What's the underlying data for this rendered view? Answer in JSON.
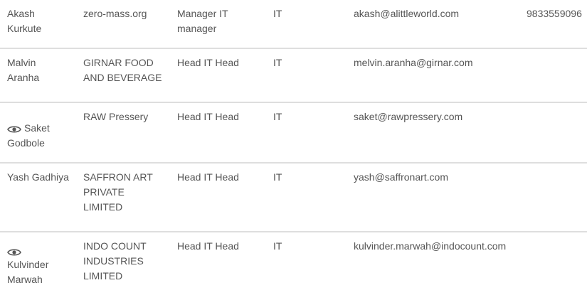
{
  "rows": [
    {
      "name": "Akash Kurkute",
      "viewed": false,
      "company": "zero-mass.org",
      "title": "Manager IT manager",
      "department": "IT",
      "email": "akash@alittleworld.com",
      "phone": "9833559096"
    },
    {
      "name": "Malvin Aranha",
      "viewed": false,
      "company": "GIRNAR FOOD AND BEVERAGE",
      "title": "Head IT Head",
      "department": "IT",
      "email": "melvin.aranha@girnar.com",
      "phone": ""
    },
    {
      "name": "Saket Godbole",
      "viewed": true,
      "company": "RAW Pressery",
      "title": "Head IT Head",
      "department": "IT",
      "email": "saket@rawpressery.com",
      "phone": ""
    },
    {
      "name": "Yash Gadhiya",
      "viewed": false,
      "company": "SAFFRON ART PRIVATE LIMITED",
      "title": "Head IT Head",
      "department": "IT",
      "email": "yash@saffronart.com",
      "phone": ""
    },
    {
      "name": "Kulvinder Marwah",
      "viewed": true,
      "company": "INDO COUNT INDUSTRIES LIMITED",
      "title": "Head IT Head",
      "department": "IT",
      "email": "kulvinder.marwah@indocount.com",
      "phone": ""
    }
  ],
  "icons": {
    "viewed": "eye-icon"
  },
  "colors": {
    "text": "#555555",
    "divider": "#dedede",
    "background": "#ffffff"
  }
}
